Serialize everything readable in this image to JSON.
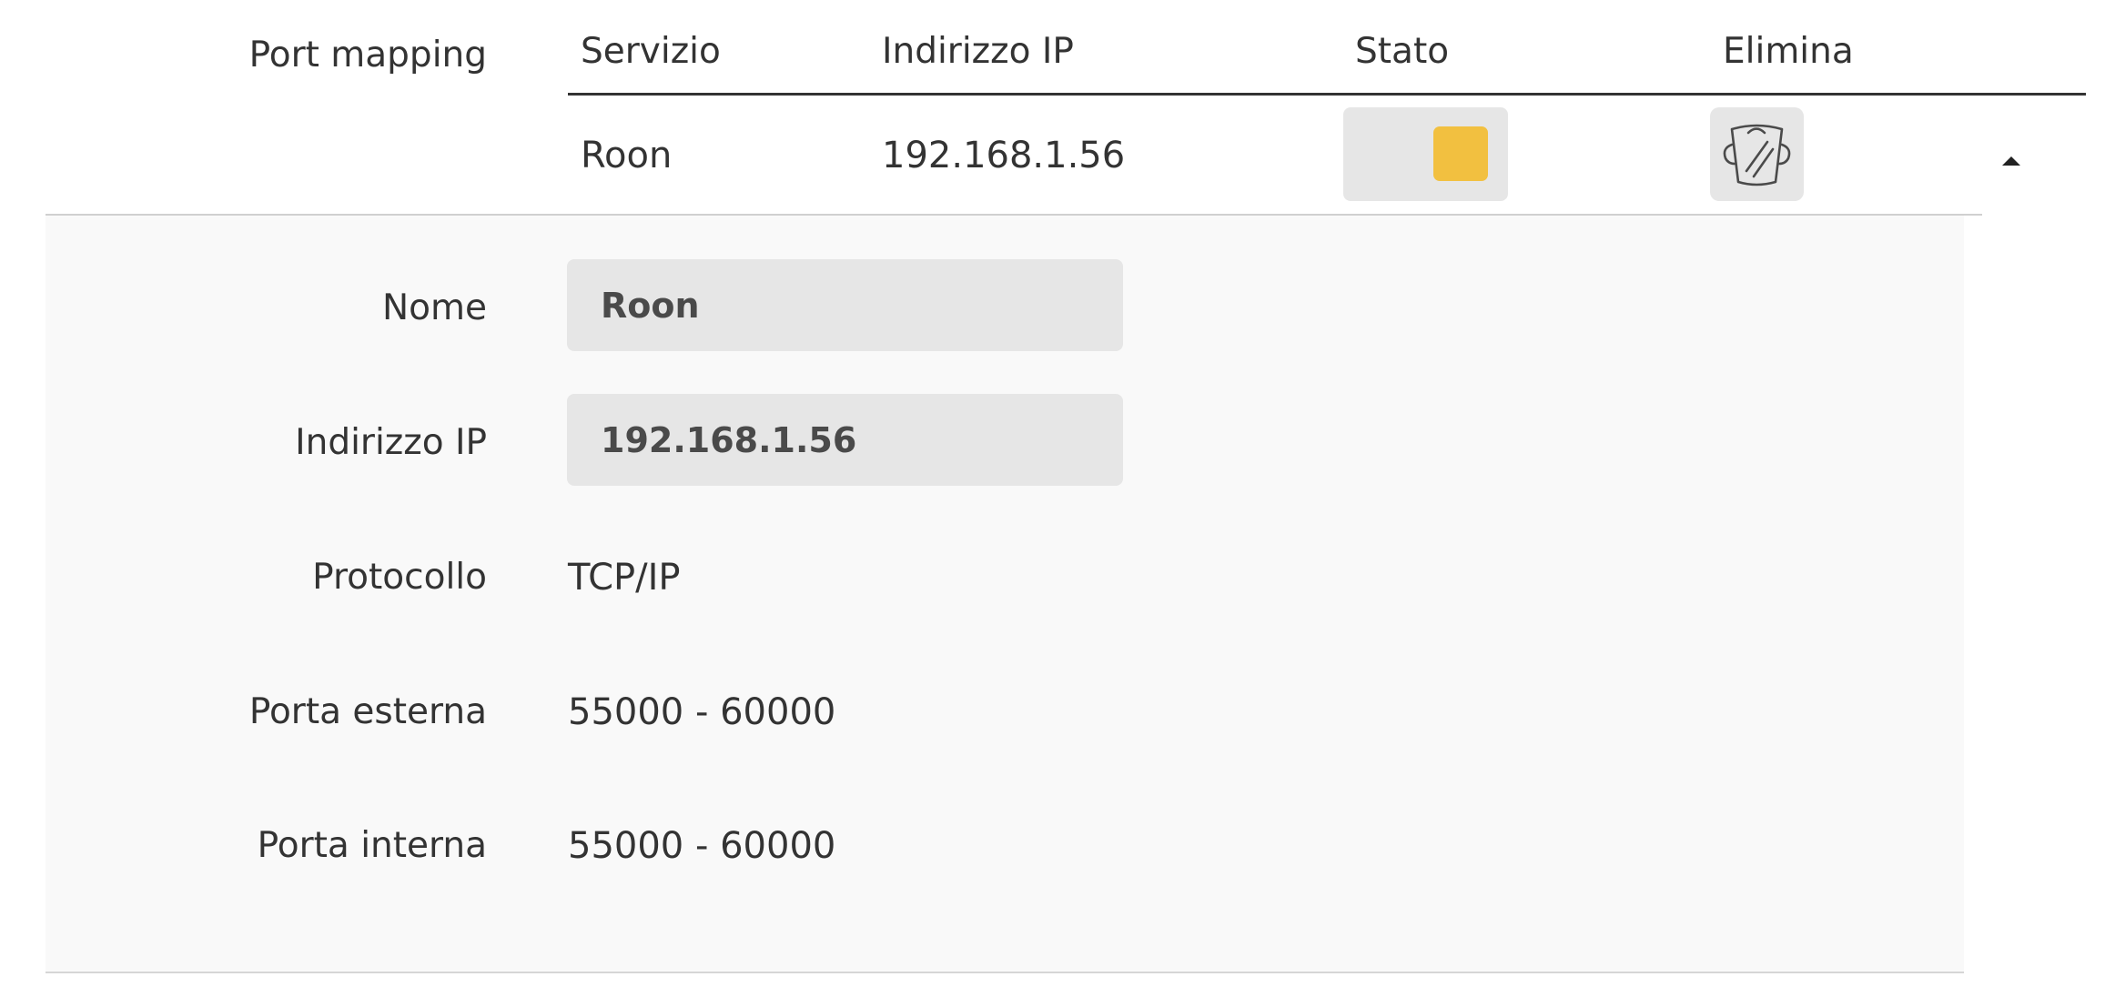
{
  "section": {
    "label": "Port mapping"
  },
  "table": {
    "headers": {
      "service": "Servizio",
      "ip": "Indirizzo IP",
      "status": "Stato",
      "delete": "Elimina"
    },
    "rows": [
      {
        "service": "Roon",
        "ip": "192.168.1.56",
        "status_on": true,
        "status_color": "#f2c040",
        "delete_icon": "trash-icon",
        "expand_icon": "chevron-up-icon"
      }
    ]
  },
  "details": {
    "name_label": "Nome",
    "name_value": "Roon",
    "ip_label": "Indirizzo IP",
    "ip_value": "192.168.1.56",
    "protocol_label": "Protocollo",
    "protocol_value": "TCP/IP",
    "external_port_label": "Porta esterna",
    "external_port_value": "55000 - 60000",
    "internal_port_label": "Porta interna",
    "internal_port_value": "55000 - 60000"
  }
}
